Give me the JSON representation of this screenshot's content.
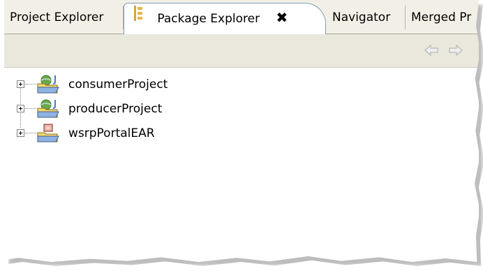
{
  "tabs": [
    {
      "label": "Project Explorer",
      "active": false
    },
    {
      "label": "Package Explorer",
      "active": true,
      "icon": "package-explorer-icon",
      "close_glyph": "✖"
    },
    {
      "label": "Navigator",
      "active": false
    },
    {
      "label": "Merged Pr",
      "active": false
    }
  ],
  "toolbar": {
    "back_icon": "back-arrow-icon",
    "forward_icon": "forward-arrow-icon"
  },
  "tree": {
    "items": [
      {
        "label": "consumerProject",
        "icon": "web-project-icon",
        "expanded": false
      },
      {
        "label": "producerProject",
        "icon": "web-project-icon",
        "expanded": false
      },
      {
        "label": "wsrpPortalEAR",
        "icon": "ear-project-icon",
        "expanded": false
      }
    ]
  },
  "colors": {
    "tabbar_bg": "#f2f0e6",
    "toolbar_bg": "#eae7dc",
    "active_tab_border": "#7f9db9",
    "folder_yellow": "#f5d76e"
  }
}
